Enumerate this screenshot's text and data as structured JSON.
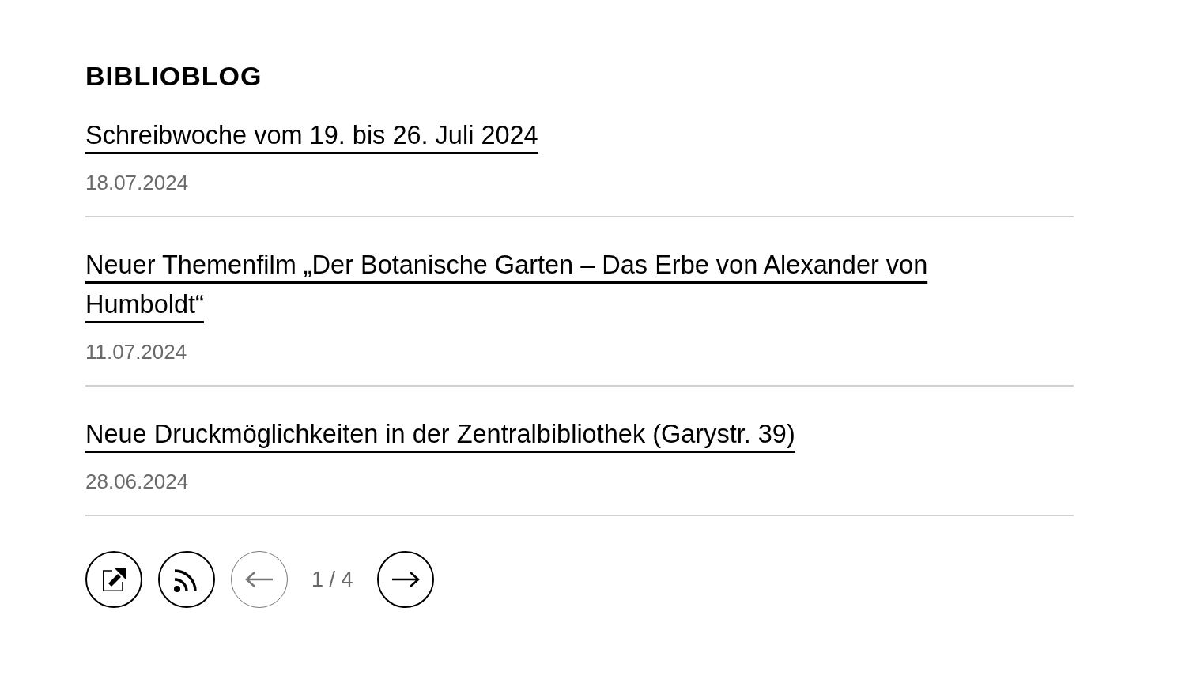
{
  "section": {
    "title": "BIBLIOBLOG"
  },
  "posts": [
    {
      "title": "Schreibwoche vom 19. bis 26. Juli 2024",
      "date": "18.07.2024"
    },
    {
      "title": "Neuer Themenfilm „Der Botanische Garten – Das Erbe von Alexander von Humboldt“",
      "date": "11.07.2024"
    },
    {
      "title": "Neue Druckmöglichkeiten in der Zentralbibliothek (Garystr. 39)",
      "date": "28.06.2024"
    }
  ],
  "pagination": [
    {
      "kind": "share",
      "disabled": false
    },
    {
      "kind": "feed",
      "disabled": false
    },
    {
      "kind": "previous",
      "disabled": true
    },
    {
      "kind": "page",
      "text": "1 / 4"
    },
    {
      "kind": "next",
      "disabled": false
    }
  ]
}
